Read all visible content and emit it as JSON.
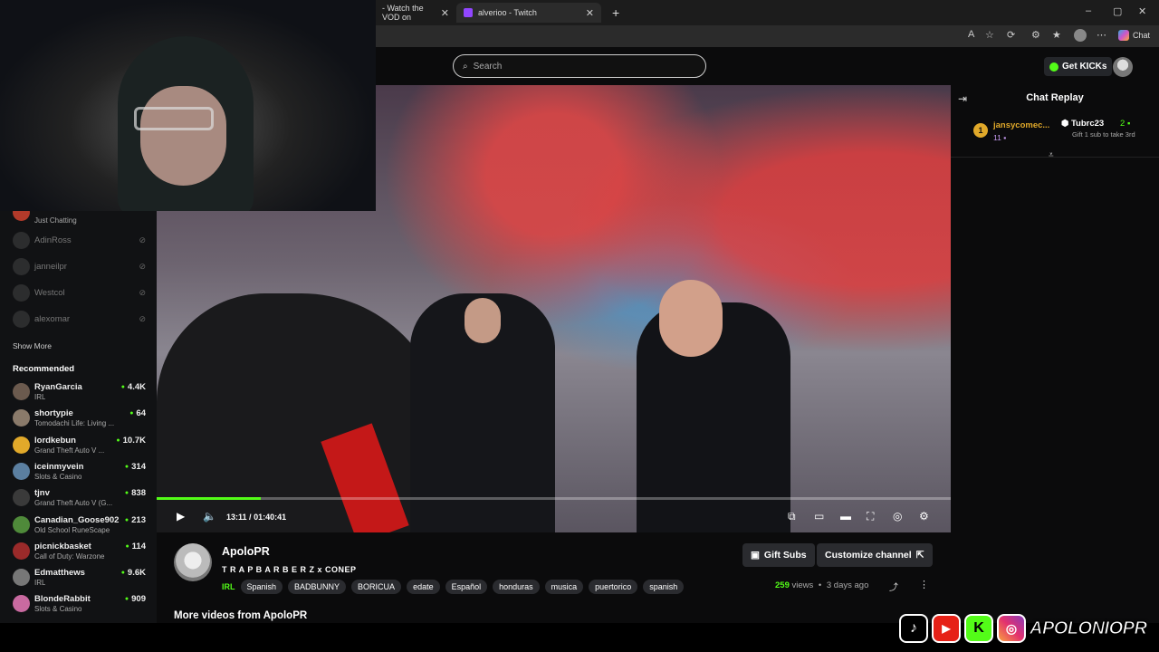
{
  "browser": {
    "tabs": [
      {
        "label": "- Watch the VOD on",
        "active": false
      },
      {
        "label": "alverioo - Twitch",
        "active": true
      }
    ],
    "copilot_label": "Chat"
  },
  "header": {
    "search_placeholder": "Search",
    "get_kicks_label": "Get KICKs"
  },
  "sidebar": {
    "following_partial": {
      "category": "Just Chatting"
    },
    "offline": [
      {
        "name": "AdinRoss"
      },
      {
        "name": "janneilpr"
      },
      {
        "name": "Westcol"
      },
      {
        "name": "alexomar"
      }
    ],
    "show_more_label": "Show More",
    "recommended_title": "Recommended",
    "recommended": [
      {
        "name": "RyanGarcia",
        "category": "IRL",
        "viewers": "4.4K",
        "color": "#6b5a4e"
      },
      {
        "name": "shortypie",
        "category": "Tomodachi Life: Living ...",
        "viewers": "64",
        "color": "#8a7a6a"
      },
      {
        "name": "lordkebun",
        "category": "Grand Theft Auto V ...",
        "viewers": "10.7K",
        "color": "#e1a92a"
      },
      {
        "name": "iceinmyvein",
        "category": "Slots & Casino",
        "viewers": "314",
        "color": "#5b7fa0"
      },
      {
        "name": "tjnv",
        "category": "Grand Theft Auto V (G...",
        "viewers": "838",
        "color": "#3a3a3a"
      },
      {
        "name": "Canadian_Goose902",
        "category": "Old School RuneScape",
        "viewers": "213",
        "color": "#4f8a3a"
      },
      {
        "name": "picnickbasket",
        "category": "Call of Duty: Warzone",
        "viewers": "114",
        "color": "#9a2a2a"
      },
      {
        "name": "Edmatthews",
        "category": "IRL",
        "viewers": "9.6K",
        "color": "#777777"
      },
      {
        "name": "BlondeRabbit",
        "category": "Slots & Casino",
        "viewers": "909",
        "color": "#c96aa0"
      }
    ]
  },
  "player": {
    "time_current": "13:11",
    "time_separator": "/",
    "time_total": "01:40:41",
    "progress_fraction": 0.131,
    "accent_color": "#53fc18"
  },
  "chat": {
    "title": "Chat Replay",
    "leaderboard": [
      {
        "rank": "1",
        "name": "jansycomec...",
        "count": "11"
      },
      {
        "name": "Tubrc23",
        "count": "2",
        "note": "Gift 1 sub to take 3rd"
      }
    ]
  },
  "channel": {
    "name": "ApoloPR",
    "video_title": "T R A P B A R B E R Z x CONEP",
    "category": "IRL",
    "tags": [
      "Spanish",
      "BADBUNNY",
      "BORICUA",
      "edate",
      "Español",
      "honduras",
      "musica",
      "puertorico",
      "spanish"
    ],
    "gift_subs_label": "Gift Subs",
    "customize_label": "Customize channel",
    "views_count": "259",
    "views_label": "views",
    "dot": "•",
    "age": "3 days ago",
    "more_videos": "More videos from ApoloPR"
  },
  "overlay": {
    "handle": "APOLONIOPR",
    "icons": [
      "tiktok-icon",
      "youtube-icon",
      "kick-icon",
      "instagram-icon"
    ]
  }
}
